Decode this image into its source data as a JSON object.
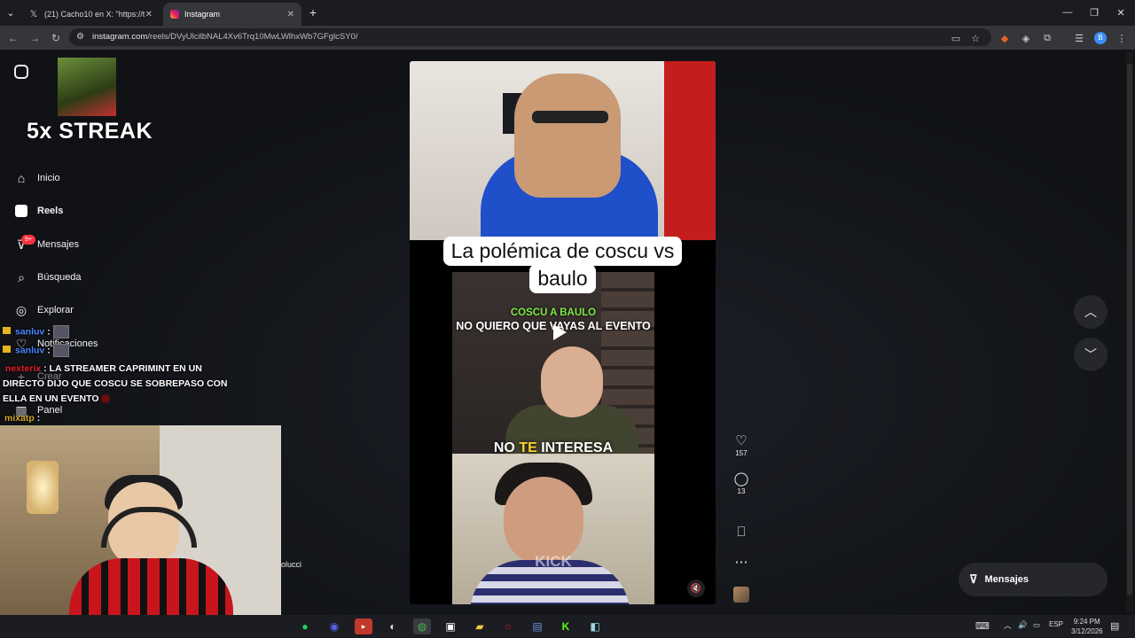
{
  "browser": {
    "tabs": [
      {
        "label": "(21) Cacho10 en X: \"https://t.co",
        "icon": "x-logo-icon"
      },
      {
        "label": "Instagram",
        "icon": "instagram-icon"
      }
    ],
    "new_tab": "+",
    "url_domain": "instagram.com",
    "url_path": "/reels/DVyUlcilbNAL4Xv6Trq10MwLWlhxWb7GFglcSY0/"
  },
  "sidebar": {
    "items": [
      {
        "label": "Inicio",
        "icon": "home-icon"
      },
      {
        "label": "Reels",
        "icon": "reels-icon"
      },
      {
        "label": "Mensajes",
        "icon": "messenger-icon",
        "badge": "9+"
      },
      {
        "label": "Búsqueda",
        "icon": "search-icon"
      },
      {
        "label": "Explorar",
        "icon": "compass-icon"
      },
      {
        "label": "Notificaciones",
        "icon": "heart-icon"
      },
      {
        "label": "Crear",
        "icon": "plus-icon"
      },
      {
        "label": "Panel",
        "icon": "chart-icon"
      }
    ]
  },
  "stream_overlay": {
    "streak": "5x STREAK",
    "chat": [
      {
        "user": "sanluv",
        "sep": ":"
      },
      {
        "user": "sanluv",
        "sep": ":"
      },
      {
        "user": "nexterix",
        "sep": ":",
        "line1": "LA STREAMER CAPRIMINT EN UN",
        "line2": "DIRECTO DIJO QUE COSCU SE SOBREPASO CON",
        "line3": "ELLA EN UN EVENTO"
      },
      {
        "user": "mixatp",
        "sep": ":"
      }
    ],
    "partial_name": "olucci"
  },
  "reel": {
    "title_line1": "La polémica de coscu vs",
    "title_line2": "baulo",
    "caption_green": "COSCU A BAULO",
    "caption_white": "NO QUIERO QUE VAYAS AL EVENTO",
    "caption_bottom_a": "NO",
    "caption_bottom_b": "TE",
    "caption_bottom_c": "INTERESA",
    "watermark": "KICK"
  },
  "actions": {
    "likes": "157",
    "comments": "13"
  },
  "messages_button": "Mensajes",
  "taskbar": {
    "lang": "ESP",
    "time": "9:24 PM",
    "date": "3/12/2026"
  },
  "colors": {
    "accent_red": "#ff3040",
    "chat_user_blue": "#4a86ff",
    "caption_green": "#7ee844"
  }
}
